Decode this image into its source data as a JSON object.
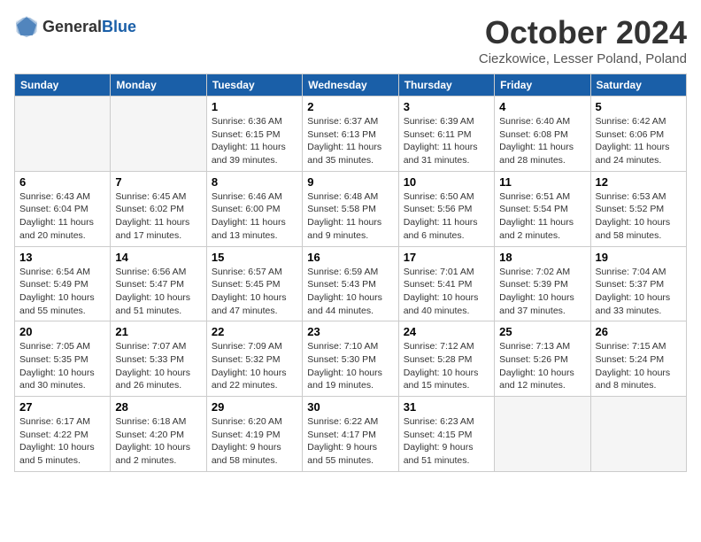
{
  "header": {
    "logo_general": "General",
    "logo_blue": "Blue",
    "title": "October 2024",
    "location": "Ciezkowice, Lesser Poland, Poland"
  },
  "days_of_week": [
    "Sunday",
    "Monday",
    "Tuesday",
    "Wednesday",
    "Thursday",
    "Friday",
    "Saturday"
  ],
  "weeks": [
    [
      {
        "day": "",
        "empty": true
      },
      {
        "day": "",
        "empty": true
      },
      {
        "day": "1",
        "sunrise": "Sunrise: 6:36 AM",
        "sunset": "Sunset: 6:15 PM",
        "daylight": "Daylight: 11 hours and 39 minutes."
      },
      {
        "day": "2",
        "sunrise": "Sunrise: 6:37 AM",
        "sunset": "Sunset: 6:13 PM",
        "daylight": "Daylight: 11 hours and 35 minutes."
      },
      {
        "day": "3",
        "sunrise": "Sunrise: 6:39 AM",
        "sunset": "Sunset: 6:11 PM",
        "daylight": "Daylight: 11 hours and 31 minutes."
      },
      {
        "day": "4",
        "sunrise": "Sunrise: 6:40 AM",
        "sunset": "Sunset: 6:08 PM",
        "daylight": "Daylight: 11 hours and 28 minutes."
      },
      {
        "day": "5",
        "sunrise": "Sunrise: 6:42 AM",
        "sunset": "Sunset: 6:06 PM",
        "daylight": "Daylight: 11 hours and 24 minutes."
      }
    ],
    [
      {
        "day": "6",
        "sunrise": "Sunrise: 6:43 AM",
        "sunset": "Sunset: 6:04 PM",
        "daylight": "Daylight: 11 hours and 20 minutes."
      },
      {
        "day": "7",
        "sunrise": "Sunrise: 6:45 AM",
        "sunset": "Sunset: 6:02 PM",
        "daylight": "Daylight: 11 hours and 17 minutes."
      },
      {
        "day": "8",
        "sunrise": "Sunrise: 6:46 AM",
        "sunset": "Sunset: 6:00 PM",
        "daylight": "Daylight: 11 hours and 13 minutes."
      },
      {
        "day": "9",
        "sunrise": "Sunrise: 6:48 AM",
        "sunset": "Sunset: 5:58 PM",
        "daylight": "Daylight: 11 hours and 9 minutes."
      },
      {
        "day": "10",
        "sunrise": "Sunrise: 6:50 AM",
        "sunset": "Sunset: 5:56 PM",
        "daylight": "Daylight: 11 hours and 6 minutes."
      },
      {
        "day": "11",
        "sunrise": "Sunrise: 6:51 AM",
        "sunset": "Sunset: 5:54 PM",
        "daylight": "Daylight: 11 hours and 2 minutes."
      },
      {
        "day": "12",
        "sunrise": "Sunrise: 6:53 AM",
        "sunset": "Sunset: 5:52 PM",
        "daylight": "Daylight: 10 hours and 58 minutes."
      }
    ],
    [
      {
        "day": "13",
        "sunrise": "Sunrise: 6:54 AM",
        "sunset": "Sunset: 5:49 PM",
        "daylight": "Daylight: 10 hours and 55 minutes."
      },
      {
        "day": "14",
        "sunrise": "Sunrise: 6:56 AM",
        "sunset": "Sunset: 5:47 PM",
        "daylight": "Daylight: 10 hours and 51 minutes."
      },
      {
        "day": "15",
        "sunrise": "Sunrise: 6:57 AM",
        "sunset": "Sunset: 5:45 PM",
        "daylight": "Daylight: 10 hours and 47 minutes."
      },
      {
        "day": "16",
        "sunrise": "Sunrise: 6:59 AM",
        "sunset": "Sunset: 5:43 PM",
        "daylight": "Daylight: 10 hours and 44 minutes."
      },
      {
        "day": "17",
        "sunrise": "Sunrise: 7:01 AM",
        "sunset": "Sunset: 5:41 PM",
        "daylight": "Daylight: 10 hours and 40 minutes."
      },
      {
        "day": "18",
        "sunrise": "Sunrise: 7:02 AM",
        "sunset": "Sunset: 5:39 PM",
        "daylight": "Daylight: 10 hours and 37 minutes."
      },
      {
        "day": "19",
        "sunrise": "Sunrise: 7:04 AM",
        "sunset": "Sunset: 5:37 PM",
        "daylight": "Daylight: 10 hours and 33 minutes."
      }
    ],
    [
      {
        "day": "20",
        "sunrise": "Sunrise: 7:05 AM",
        "sunset": "Sunset: 5:35 PM",
        "daylight": "Daylight: 10 hours and 30 minutes."
      },
      {
        "day": "21",
        "sunrise": "Sunrise: 7:07 AM",
        "sunset": "Sunset: 5:33 PM",
        "daylight": "Daylight: 10 hours and 26 minutes."
      },
      {
        "day": "22",
        "sunrise": "Sunrise: 7:09 AM",
        "sunset": "Sunset: 5:32 PM",
        "daylight": "Daylight: 10 hours and 22 minutes."
      },
      {
        "day": "23",
        "sunrise": "Sunrise: 7:10 AM",
        "sunset": "Sunset: 5:30 PM",
        "daylight": "Daylight: 10 hours and 19 minutes."
      },
      {
        "day": "24",
        "sunrise": "Sunrise: 7:12 AM",
        "sunset": "Sunset: 5:28 PM",
        "daylight": "Daylight: 10 hours and 15 minutes."
      },
      {
        "day": "25",
        "sunrise": "Sunrise: 7:13 AM",
        "sunset": "Sunset: 5:26 PM",
        "daylight": "Daylight: 10 hours and 12 minutes."
      },
      {
        "day": "26",
        "sunrise": "Sunrise: 7:15 AM",
        "sunset": "Sunset: 5:24 PM",
        "daylight": "Daylight: 10 hours and 8 minutes."
      }
    ],
    [
      {
        "day": "27",
        "sunrise": "Sunrise: 6:17 AM",
        "sunset": "Sunset: 4:22 PM",
        "daylight": "Daylight: 10 hours and 5 minutes."
      },
      {
        "day": "28",
        "sunrise": "Sunrise: 6:18 AM",
        "sunset": "Sunset: 4:20 PM",
        "daylight": "Daylight: 10 hours and 2 minutes."
      },
      {
        "day": "29",
        "sunrise": "Sunrise: 6:20 AM",
        "sunset": "Sunset: 4:19 PM",
        "daylight": "Daylight: 9 hours and 58 minutes."
      },
      {
        "day": "30",
        "sunrise": "Sunrise: 6:22 AM",
        "sunset": "Sunset: 4:17 PM",
        "daylight": "Daylight: 9 hours and 55 minutes."
      },
      {
        "day": "31",
        "sunrise": "Sunrise: 6:23 AM",
        "sunset": "Sunset: 4:15 PM",
        "daylight": "Daylight: 9 hours and 51 minutes."
      },
      {
        "day": "",
        "empty": true
      },
      {
        "day": "",
        "empty": true
      }
    ]
  ]
}
